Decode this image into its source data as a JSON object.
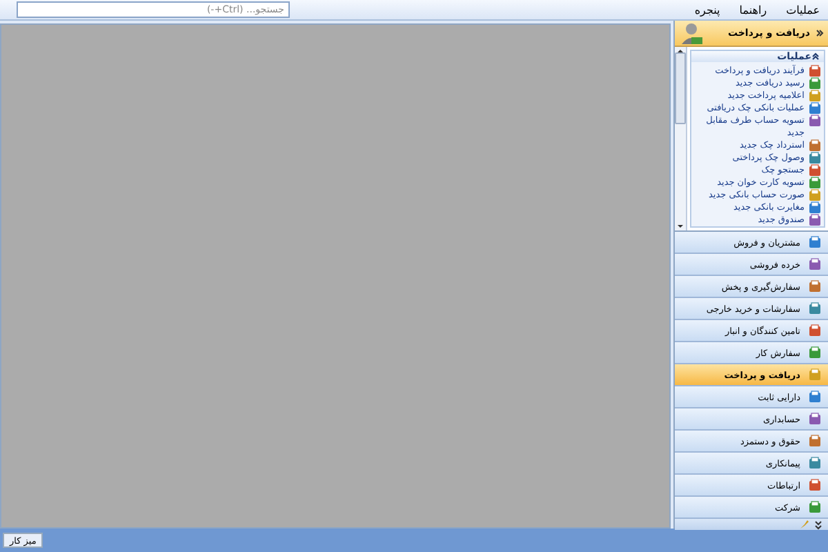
{
  "menu": [
    {
      "label": "عملیات"
    },
    {
      "label": "راهنما"
    },
    {
      "label": "پنجره"
    }
  ],
  "search": {
    "placeholder": "جستجو... (Ctrl+-)"
  },
  "sidebar": {
    "title": "دریافت و پرداخت",
    "tasks": {
      "title": "عملیات",
      "items": [
        {
          "label": "فرآیند دریافت و پرداخت"
        },
        {
          "label": "رسید دریافت جدید"
        },
        {
          "label": "اعلامیه پرداخت جدید"
        },
        {
          "label": "عملیات بانکی چک دریافتی"
        },
        {
          "label": "تسویه حساب طرف مقابل جدید"
        },
        {
          "label": "استرداد چک جدید"
        },
        {
          "label": "وصول چک پرداختی"
        },
        {
          "label": "جستجو چک"
        },
        {
          "label": "تسویه کارت خوان جدید"
        },
        {
          "label": "صورت حساب بانکی جدید"
        },
        {
          "label": "مغایرت بانکی جدید"
        },
        {
          "label": "صندوق جدید"
        }
      ]
    },
    "nav": [
      {
        "label": "مشتریان و فروش",
        "selected": false
      },
      {
        "label": "خرده فروشی",
        "selected": false
      },
      {
        "label": "سفارش‌گیری و پخش",
        "selected": false
      },
      {
        "label": "سفارشات و خرید خارجی",
        "selected": false
      },
      {
        "label": "تامین کنندگان و انبار",
        "selected": false
      },
      {
        "label": "سفارش کار",
        "selected": false
      },
      {
        "label": "دریافت و پرداخت",
        "selected": true
      },
      {
        "label": "دارایی ثابت",
        "selected": false
      },
      {
        "label": "حسابداری",
        "selected": false
      },
      {
        "label": "حقوق و دستمزد",
        "selected": false
      },
      {
        "label": "پیمانکاری",
        "selected": false
      },
      {
        "label": "ارتباطات",
        "selected": false
      },
      {
        "label": "شرکت",
        "selected": false
      }
    ]
  },
  "status_bar": {
    "tab": "میز کار"
  }
}
